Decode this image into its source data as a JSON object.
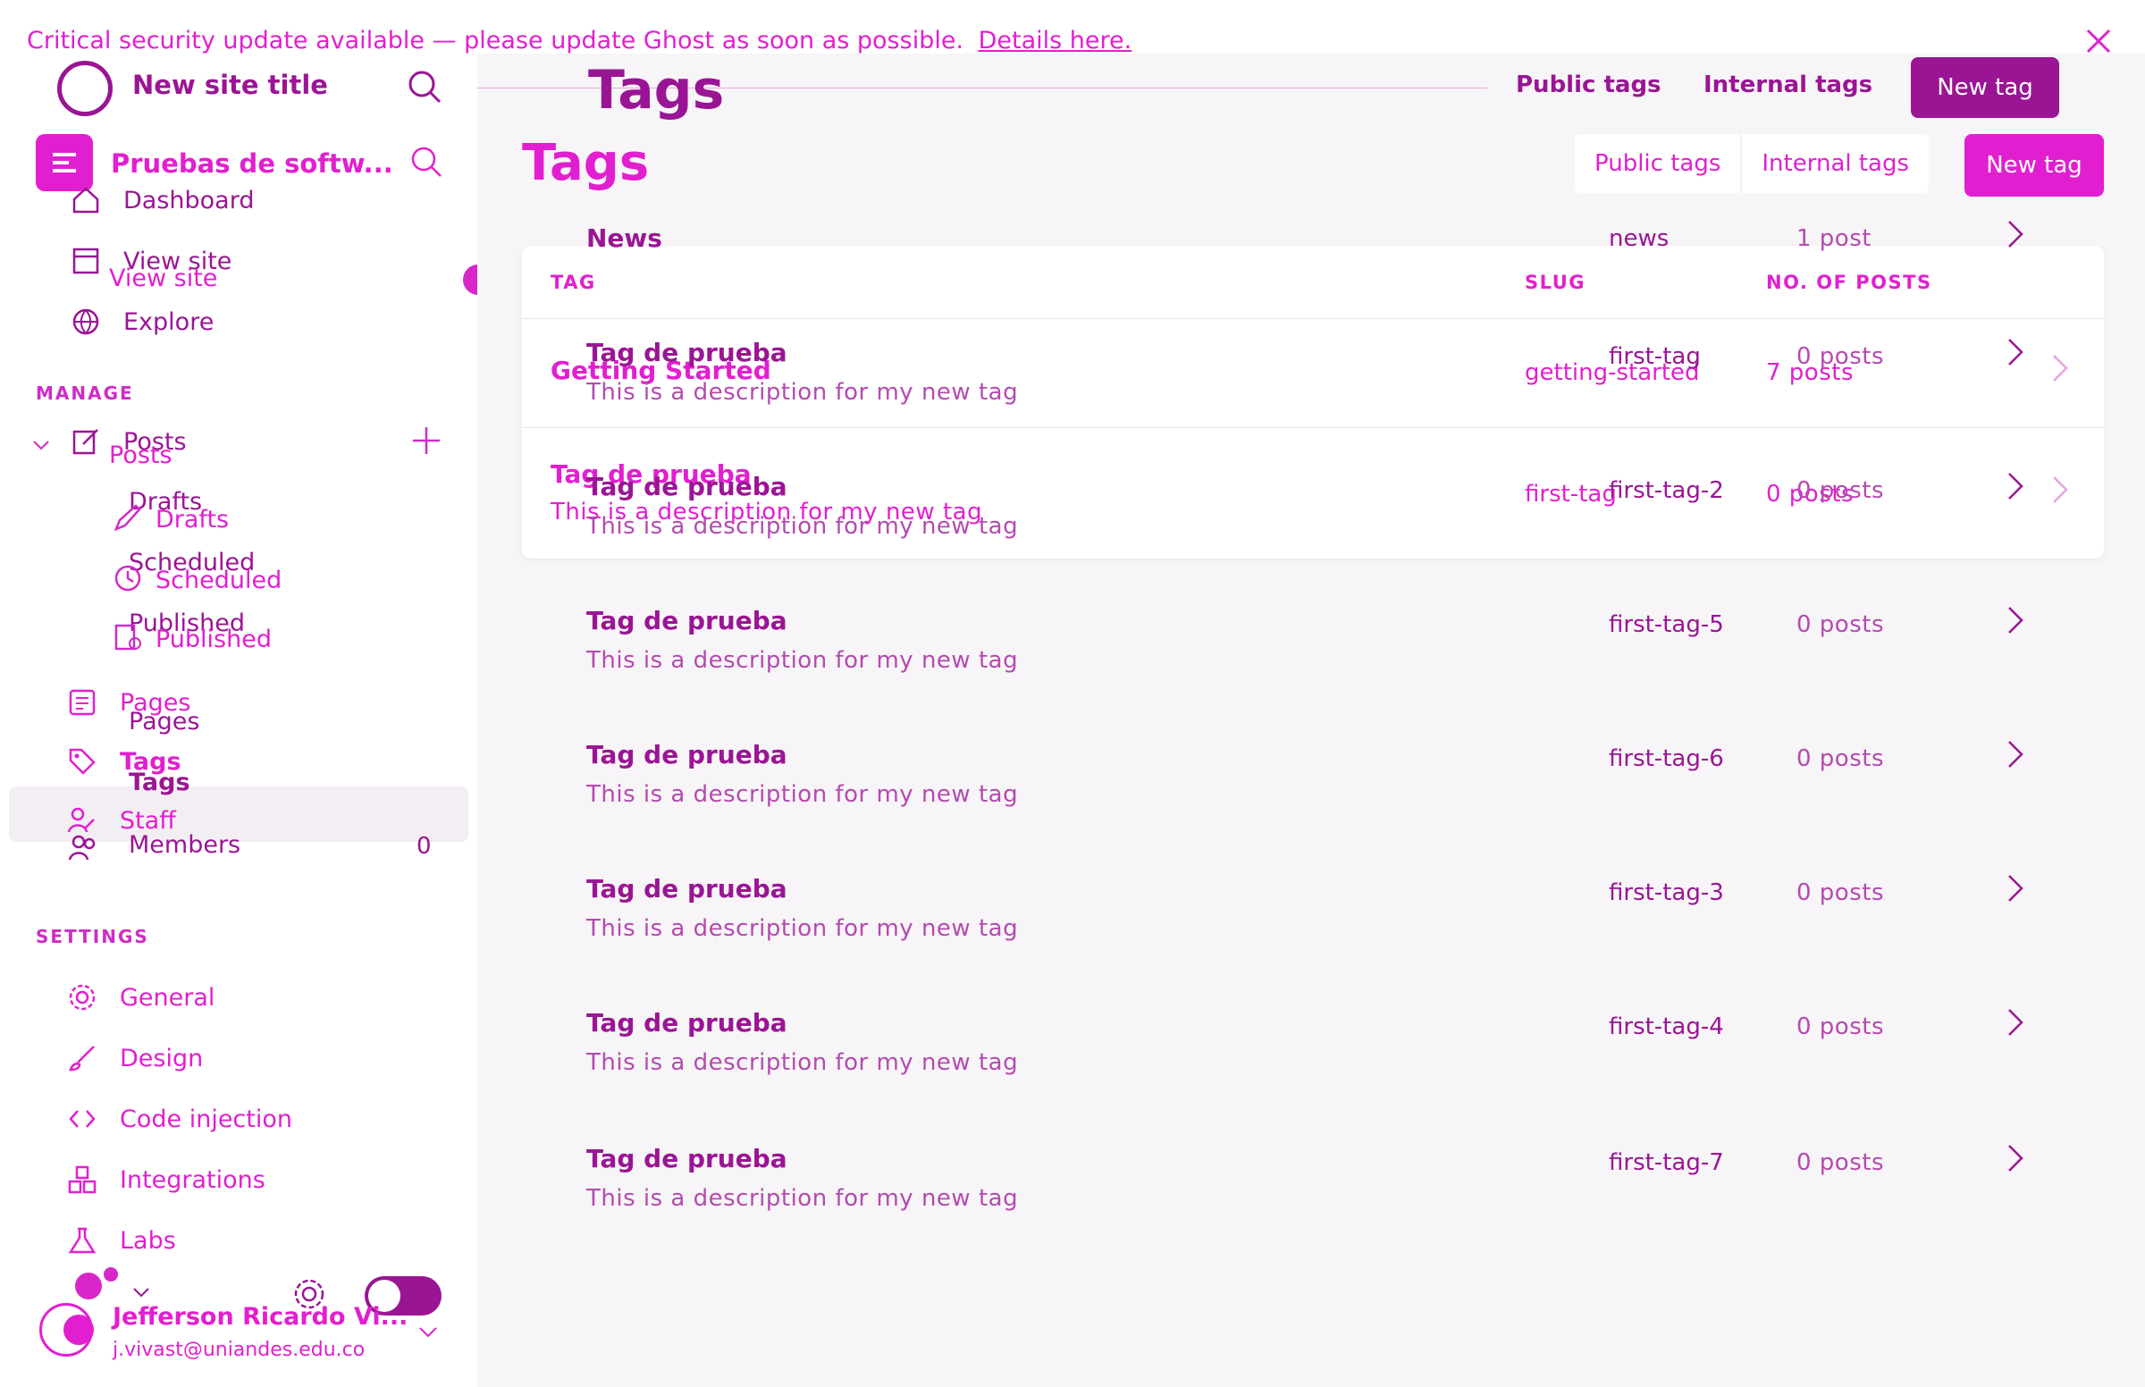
{
  "banner": {
    "text": "Critical security update available — please update Ghost as soon as possible.",
    "link": "Details here."
  },
  "site": {
    "title": "New site title",
    "name": "Pruebas de softw..."
  },
  "nav": {
    "dashboard": "Dashboard",
    "view_site": "View site",
    "explore": "Explore",
    "manage_heading": "MANAGE",
    "posts": "Posts",
    "drafts": "Drafts",
    "scheduled": "Scheduled",
    "published": "Published",
    "pages": "Pages",
    "tags": "Tags",
    "staff": "Staff",
    "members": "Members",
    "members_count": "0",
    "settings_heading": "SETTINGS",
    "general": "General",
    "design": "Design",
    "code_injection": "Code injection",
    "integrations": "Integrations",
    "labs": "Labs"
  },
  "user": {
    "name": "Jefferson Ricardo Vi...",
    "email": "j.vivast@uniandes.edu.co"
  },
  "page": {
    "title": "Tags",
    "tab_public": "Public tags",
    "tab_internal": "Internal tags",
    "new_tag": "New tag"
  },
  "table": {
    "col_tag": "TAG",
    "col_slug": "SLUG",
    "col_posts": "NO. OF POSTS",
    "front_rows": [
      {
        "name": "Getting Started",
        "desc": "",
        "slug": "getting-started",
        "count": "7 posts"
      },
      {
        "name": "Tag de prueba",
        "desc": "This is a description for my new tag",
        "slug": "first-tag",
        "count": "0 posts"
      }
    ],
    "back_rows": [
      {
        "name": "News",
        "desc": "",
        "slug": "news",
        "count": "1 post"
      },
      {
        "name": "Tag de prueba",
        "desc": "This is a description for my new tag",
        "slug": "first-tag",
        "count": "0 posts"
      },
      {
        "name": "Tag de prueba",
        "desc": "This is a description for my new tag",
        "slug": "first-tag-2",
        "count": "0 posts"
      },
      {
        "name": "Tag de prueba",
        "desc": "This is a description for my new tag",
        "slug": "first-tag-5",
        "count": "0 posts"
      },
      {
        "name": "Tag de prueba",
        "desc": "This is a description for my new tag",
        "slug": "first-tag-6",
        "count": "0 posts"
      },
      {
        "name": "Tag de prueba",
        "desc": "This is a description for my new tag",
        "slug": "first-tag-3",
        "count": "0 posts"
      },
      {
        "name": "Tag de prueba",
        "desc": "This is a description for my new tag",
        "slug": "first-tag-4",
        "count": "0 posts"
      },
      {
        "name": "Tag de prueba",
        "desc": "This is a description for my new tag",
        "slug": "first-tag-7",
        "count": "0 posts"
      }
    ]
  },
  "colors": {
    "accent": "#e21fd0",
    "accent_dark": "#9a1594",
    "main_bg": "#f7f5f7"
  }
}
